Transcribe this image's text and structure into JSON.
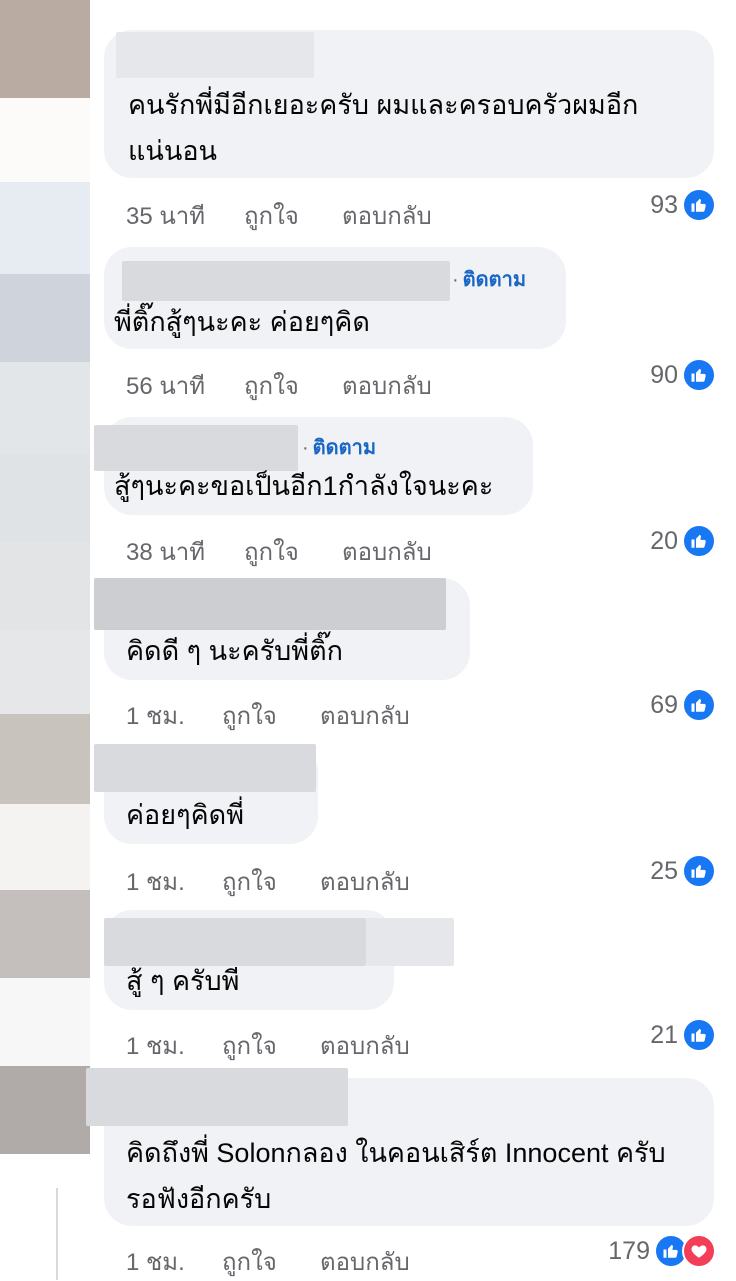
{
  "comments": [
    {
      "text": "คนรักพี่มีอีกเยอะครับ ผมและครอบครัวผมอีก\nแน่นอน",
      "time": "35 นาที",
      "like_label": "ถูกใจ",
      "reply_label": "ตอบกลับ",
      "reactions": "93",
      "follow": ""
    },
    {
      "text": "พี่ติ๊กสู้ๆนะคะ ค่อยๆคิด",
      "time": "56 นาที",
      "like_label": "ถูกใจ",
      "reply_label": "ตอบกลับ",
      "reactions": "90",
      "follow": "ติดตาม"
    },
    {
      "text": "สู้ๆนะคะขอเป็นอีก1กำลังใจนะคะ",
      "time": "38 นาที",
      "like_label": "ถูกใจ",
      "reply_label": "ตอบกลับ",
      "reactions": "20",
      "follow": "ติดตาม"
    },
    {
      "text": "คิดดี ๆ นะครับพี่ติ๊ก",
      "time": "1 ชม.",
      "like_label": "ถูกใจ",
      "reply_label": "ตอบกลับ",
      "reactions": "69",
      "follow": ""
    },
    {
      "text": "ค่อยๆคิดพี่",
      "time": "1 ชม.",
      "like_label": "ถูกใจ",
      "reply_label": "ตอบกลับ",
      "reactions": "25",
      "follow": ""
    },
    {
      "text": "สู้ ๆ ครับพี",
      "time": "1 ชม.",
      "like_label": "ถูกใจ",
      "reply_label": "ตอบกลับ",
      "reactions": "21",
      "follow": ""
    },
    {
      "text": "คิดถึงพี่ Solonกลอง ในคอนเสิร์ต Innocent ครับ\nรอฟังอีกครับ",
      "time": "1 ชม.",
      "like_label": "ถูกใจ",
      "reply_label": "ตอบกลับ",
      "reactions": "179",
      "follow": ""
    }
  ],
  "colors": {
    "bubble": "#f0f2f5",
    "link_blue": "#1a66c5",
    "like_blue": "#1877f2",
    "love_red": "#f33e58",
    "meta_gray": "#65676b"
  },
  "icons": {
    "like": "thumbs-up-icon",
    "love": "heart-icon"
  }
}
